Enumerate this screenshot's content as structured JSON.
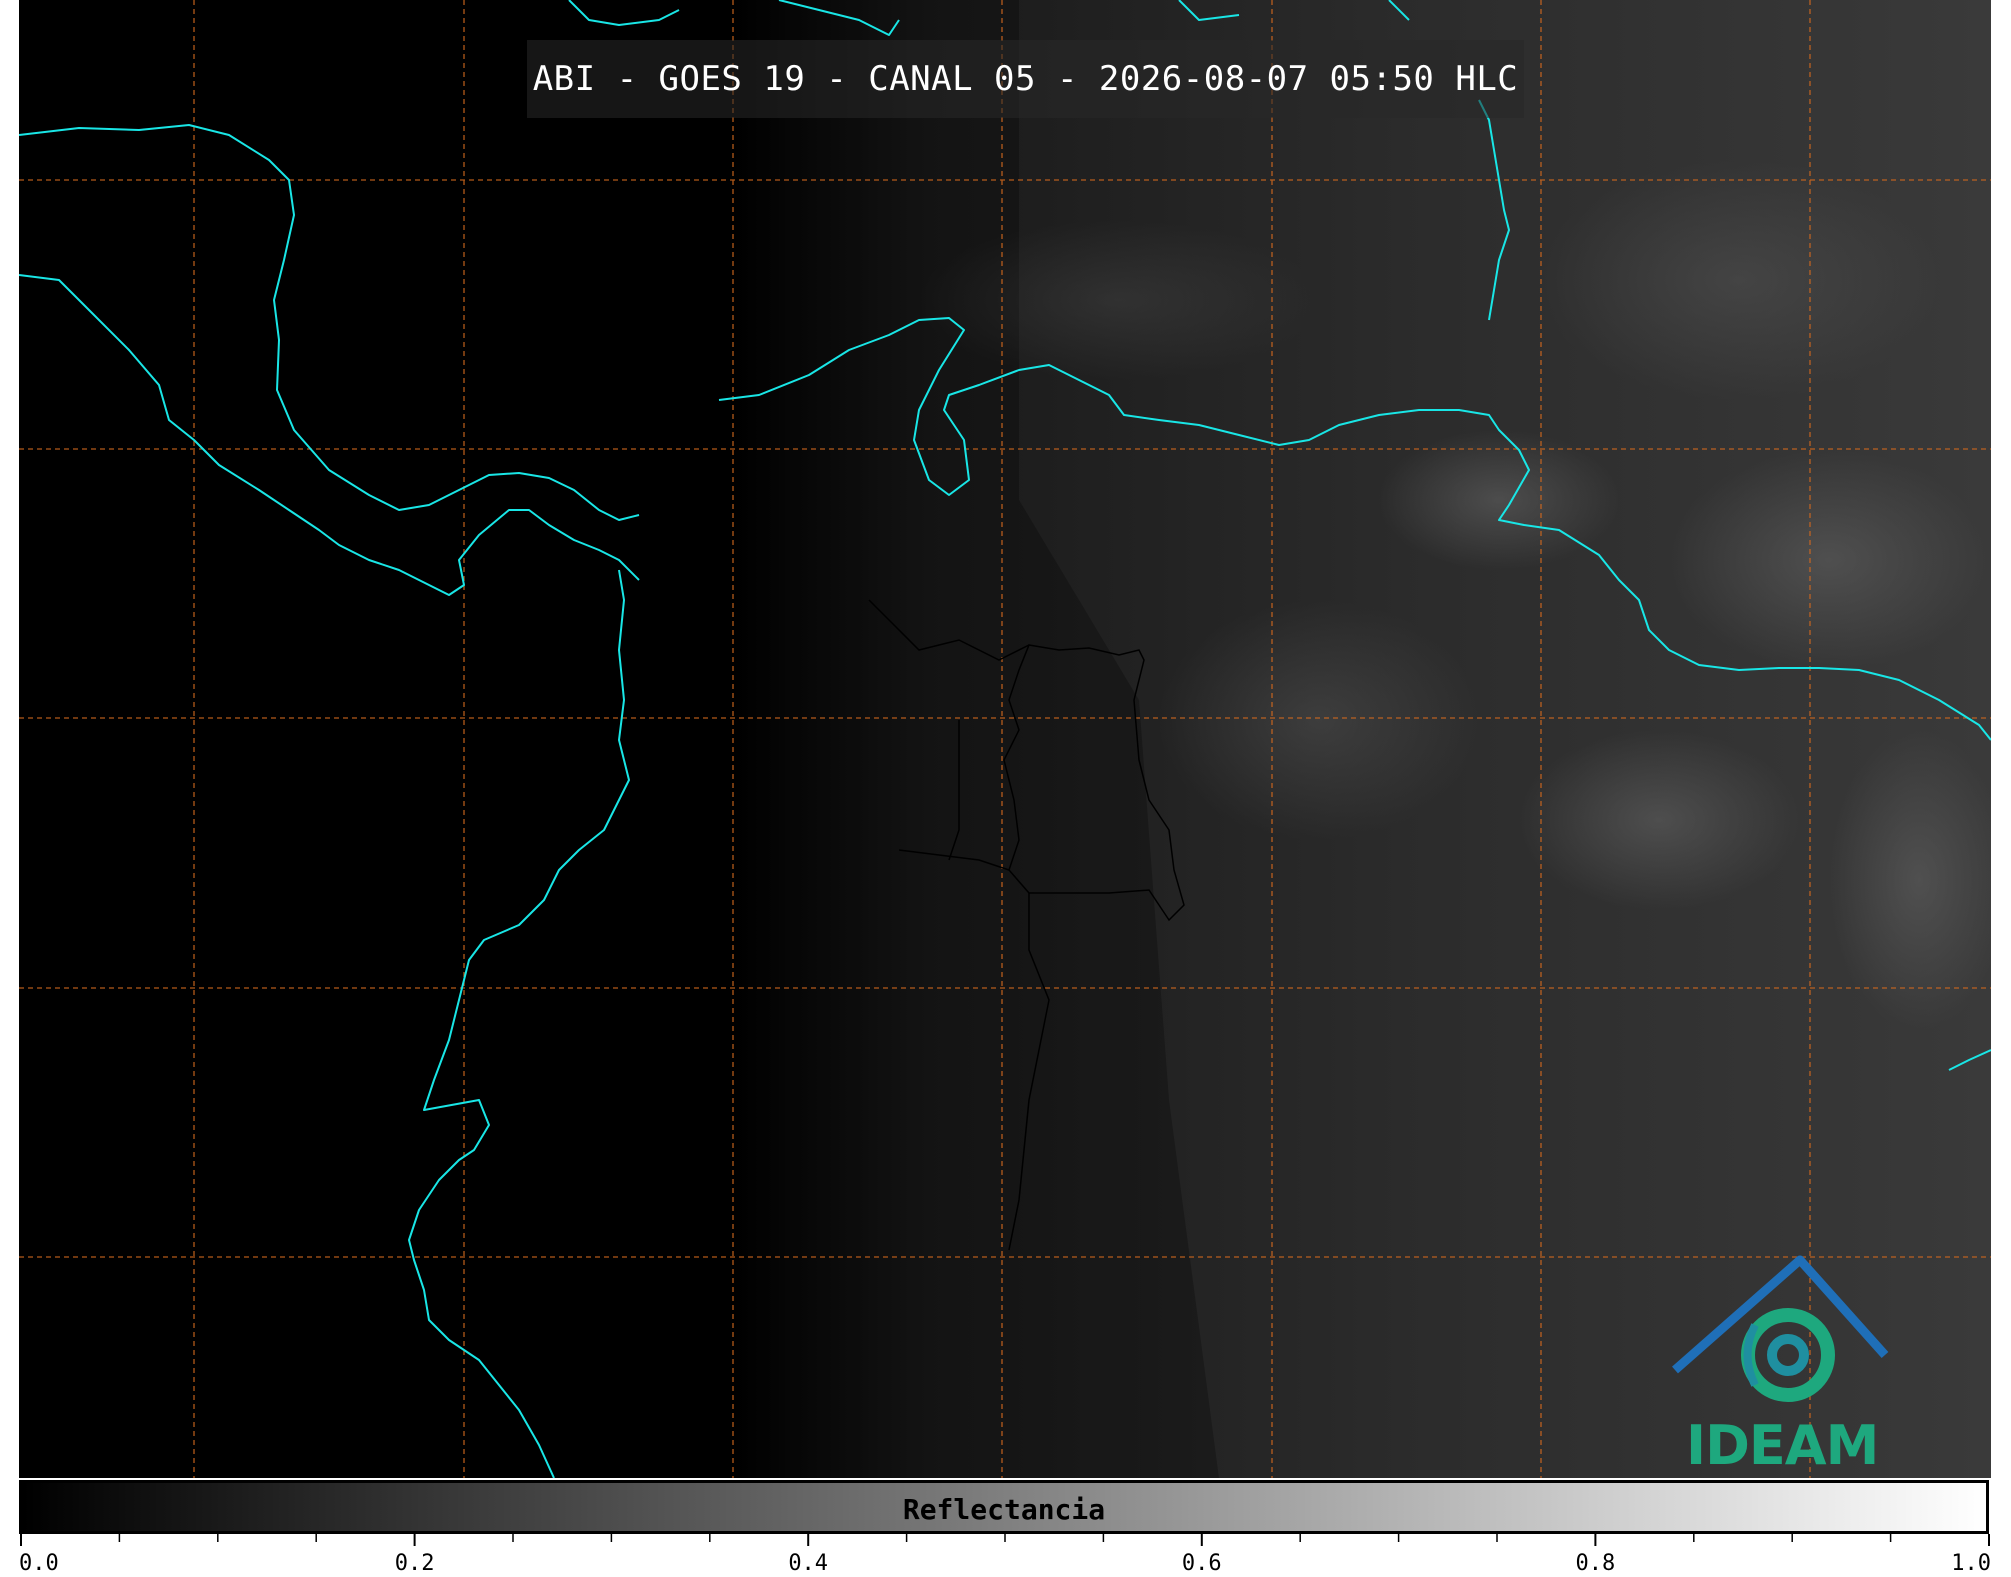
{
  "title": "ABI - GOES 19 - CANAL 05 - 2026-08-07 05:50 HLC",
  "logo": {
    "text": "IDEAM"
  },
  "colorbar": {
    "label": "Reflectancia",
    "min": 0.0,
    "max": 1.0,
    "major_ticks": [
      "0.0",
      "0.2",
      "0.4",
      "0.6",
      "0.8",
      "1.0"
    ],
    "minor_step": 0.05
  },
  "colors": {
    "coastline": "#19e6e6",
    "graticule": "#d2691e",
    "borders": "#000000",
    "logo_green": "#1ea87e",
    "logo_blue": "#1f6fb8"
  },
  "map": {
    "graticule": true,
    "style": "dashed"
  }
}
